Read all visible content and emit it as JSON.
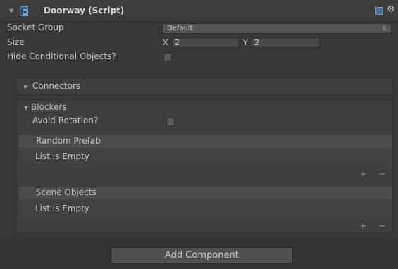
{
  "component": {
    "title": "Doorway (Script)",
    "icon": "script-icon"
  },
  "socket_group": {
    "label": "Socket Group",
    "value": "Default"
  },
  "size": {
    "label": "Size",
    "x_label": "X",
    "x_value": "2",
    "y_label": "Y",
    "y_value": "2"
  },
  "hide_conditional": {
    "label": "Hide Conditional Objects?",
    "checked": false
  },
  "connectors": {
    "label": "Connectors",
    "expanded": false
  },
  "blockers": {
    "label": "Blockers",
    "expanded": true,
    "avoid_rotation": {
      "label": "Avoid Rotation?",
      "checked": false
    },
    "lists": [
      {
        "header": "Random Prefab",
        "empty_text": "List is Empty",
        "add": "+",
        "remove": "−"
      },
      {
        "header": "Scene Objects",
        "empty_text": "List is Empty",
        "add": "+",
        "remove": "−"
      }
    ]
  },
  "add_component_label": "Add Component"
}
